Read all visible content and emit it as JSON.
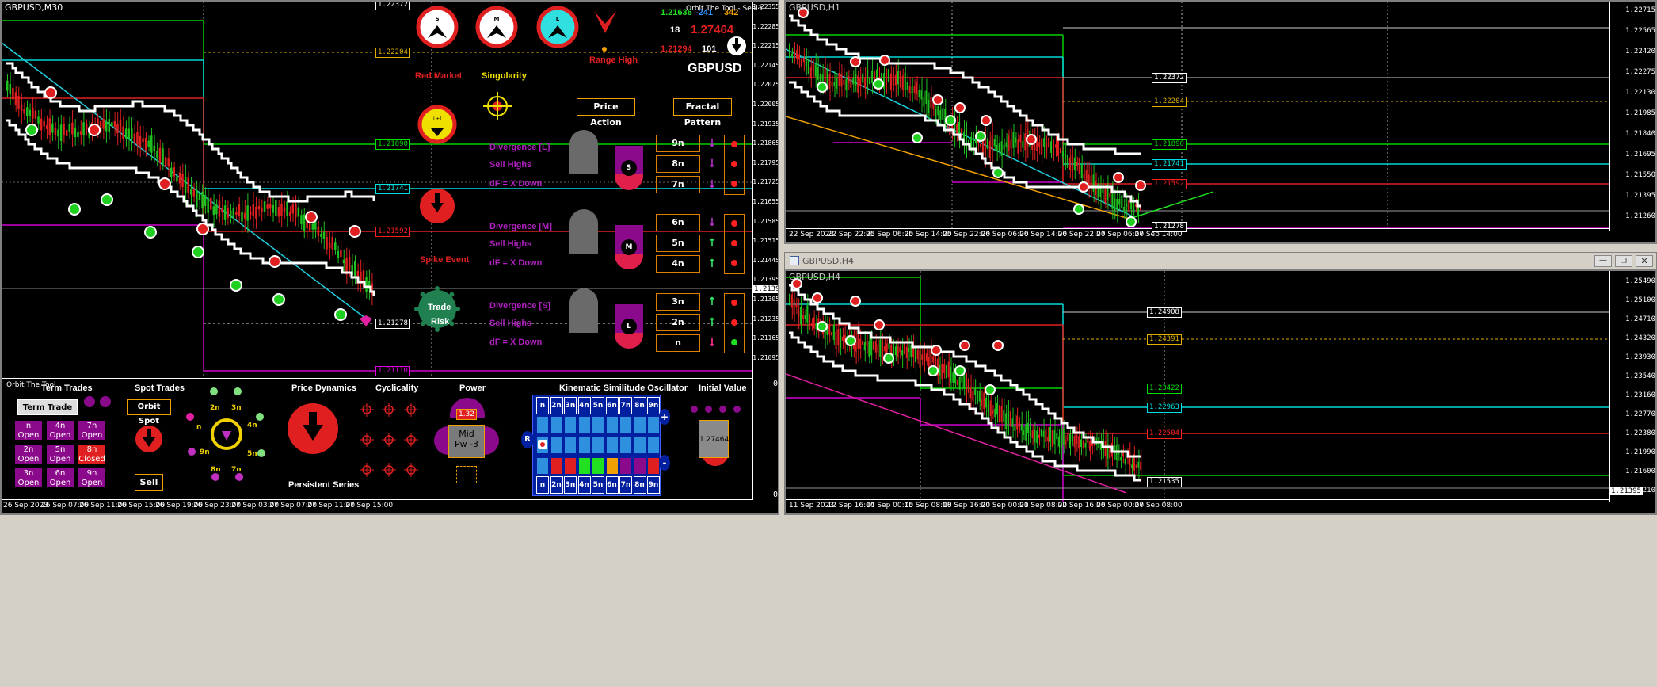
{
  "main": {
    "title": "GBPUSD,M30",
    "indicator_title": "Orbit The Tool - Seal3",
    "y_ticks": [
      "1.22355",
      "1.22285",
      "1.22215",
      "1.22145",
      "1.22075",
      "1.22005",
      "1.21935",
      "1.21865",
      "1.21795",
      "1.21725",
      "1.21655",
      "1.21585",
      "1.21515",
      "1.21445",
      "1.21395",
      "1.21305",
      "1.21235",
      "1.21165",
      "1.21095"
    ],
    "x_ticks": [
      "26 Sep 2023",
      "26 Sep 07:00",
      "26 Sep 11:00",
      "26 Sep 15:00",
      "26 Sep 19:00",
      "26 Sep 23:00",
      "27 Sep 03:00",
      "27 Sep 07:00",
      "27 Sep 11:00",
      "27 Sep 15:00"
    ],
    "pills": [
      {
        "text": "1.22204",
        "color": "#e0b000"
      },
      {
        "text": "1.21890",
        "color": "#00e000"
      },
      {
        "text": "1.21741",
        "color": "#00e0e0"
      },
      {
        "text": "1.21592",
        "color": "#ff2020"
      },
      {
        "text": "1.21278",
        "color": "#ffffff"
      },
      {
        "text": "1.21110",
        "color": "#e000e0"
      },
      {
        "text": "1.22372",
        "color": "#ffffff"
      }
    ],
    "current_price": "1.21395",
    "sub_ticks": [
      "0",
      "0"
    ]
  },
  "indicators": {
    "market_labels": [
      "S",
      "M",
      "L"
    ],
    "red_market": "Red Market",
    "singularity": "Singularity",
    "range_high": "Range High",
    "spike_event": "Spike Event",
    "trade_risk_1": "Trade",
    "trade_risk_2": "Risk",
    "lh": "L+l",
    "price_action": "Price Action",
    "fractal_pattern": "Fractal Pattern",
    "symbol": "GBPUSD",
    "top_vals": {
      "a": "1.21636",
      "b": "-241",
      "c": "342",
      "d": "18",
      "e": "1.27464",
      "f": "1.21294",
      "g": "101"
    },
    "divergence": [
      {
        "title": "Divergence [L]",
        "sell": "Sell Highs",
        "df": "dF = X Down",
        "badge": "S",
        "boxes": [
          "9n",
          "8n",
          "7n"
        ],
        "arrows": [
          "down",
          "down",
          "down"
        ],
        "dots": [
          "#ff2020",
          "#ff2020",
          "#ff2020"
        ]
      },
      {
        "title": "Divergence [M]",
        "sell": "Sell Highs",
        "df": "dF = X Down",
        "badge": "M",
        "boxes": [
          "6n",
          "5n",
          "4n"
        ],
        "arrows": [
          "down",
          "up",
          "up"
        ],
        "dots": [
          "#ff2020",
          "#ff2020",
          "#ff2020"
        ]
      },
      {
        "title": "Divergence [S]",
        "sell": "Sell Highs",
        "df": "dF = X Down",
        "badge": "L",
        "boxes": [
          "3n",
          "2n",
          "n"
        ],
        "arrows": [
          "up",
          "up",
          "downpink"
        ],
        "dots": [
          "#ff2020",
          "#ff2020",
          "#20e020"
        ]
      }
    ]
  },
  "panel": {
    "title": "Orbit The Tool",
    "term_trades": "Term Trades",
    "term_trade_hold": "Term Trade [Hold]",
    "term_buttons": [
      {
        "l1": "n",
        "l2": "Open",
        "color": "#8b0a8b"
      },
      {
        "l1": "4n",
        "l2": "Open",
        "color": "#8b0a8b"
      },
      {
        "l1": "7n",
        "l2": "Open",
        "color": "#8b0a8b"
      },
      {
        "l1": "2n",
        "l2": "Open",
        "color": "#8b0a8b"
      },
      {
        "l1": "5n",
        "l2": "Open",
        "color": "#8b0a8b"
      },
      {
        "l1": "8n",
        "l2": "Closed",
        "color": "#e02020"
      },
      {
        "l1": "3n",
        "l2": "Open",
        "color": "#8b0a8b"
      },
      {
        "l1": "6n",
        "l2": "Open",
        "color": "#8b0a8b"
      },
      {
        "l1": "9n",
        "l2": "Open",
        "color": "#8b0a8b"
      }
    ],
    "spot_trades": "Spot Trades",
    "orbit_spot": "Orbit Spot",
    "sell": "Sell",
    "orbit_labels": [
      "2n",
      "3n",
      "4n",
      "5n",
      "7n",
      "8n",
      "9n",
      "n"
    ],
    "price_dynamics": "Price Dynamics",
    "persistent_series": "Persistent Series",
    "cyclicality": "Cyclicality",
    "power": "Power",
    "power_val": "1.32",
    "power_mid": "Mid",
    "power_pw": "Pw -3",
    "kso_title": "Kinematic Similitude Oscillator",
    "kso_header": [
      "n",
      "2n",
      "3n",
      "4n",
      "5n",
      "6n",
      "7n",
      "8n",
      "9n"
    ],
    "kso_r": "R",
    "kso_plus": "+",
    "kso_minus": "-",
    "kso_row3": [
      "#3090e0",
      "#e02020",
      "#e02020",
      "#20e020",
      "#20e020",
      "#f0a000",
      "#8b0a8b",
      "#8b0a8b",
      "#e02020"
    ],
    "initial_value": "Initial Value",
    "initial_price": "1.27464"
  },
  "h1": {
    "title": "GBPUSD,H1",
    "win_title": "GBPUSD,H1",
    "y_ticks": [
      "1.22715",
      "1.22565",
      "1.22420",
      "1.22275",
      "1.22130",
      "1.21985",
      "1.21840",
      "1.21695",
      "1.21550",
      "1.21395",
      "1.21260"
    ],
    "x_ticks": [
      "22 Sep 2023",
      "22 Sep 22:00",
      "25 Sep 06:00",
      "25 Sep 14:00",
      "25 Sep 22:00",
      "26 Sep 06:00",
      "26 Sep 14:00",
      "26 Sep 22:00",
      "27 Sep 06:00",
      "27 Sep 14:00"
    ],
    "pills": [
      {
        "text": "1.22372",
        "color": "#ffffff"
      },
      {
        "text": "1.22204",
        "color": "#e0b000"
      },
      {
        "text": "1.21890",
        "color": "#00e000"
      },
      {
        "text": "1.21741",
        "color": "#00e0e0"
      },
      {
        "text": "1.21592",
        "color": "#ff2020"
      },
      {
        "text": "1.21278",
        "color": "#ffffff"
      }
    ]
  },
  "h4": {
    "title": "GBPUSD,H4",
    "win_title": "GBPUSD,H4",
    "y_ticks": [
      "1.25490",
      "1.25100",
      "1.24710",
      "1.24320",
      "1.23930",
      "1.23540",
      "1.23160",
      "1.22770",
      "1.22380",
      "1.21990",
      "1.21600",
      "1.21210"
    ],
    "x_ticks": [
      "11 Sep 2023",
      "12 Sep 16:00",
      "14 Sep 00:00",
      "15 Sep 08:00",
      "18 Sep 16:00",
      "20 Sep 00:00",
      "21 Sep 08:00",
      "22 Sep 16:00",
      "26 Sep 00:00",
      "27 Sep 08:00"
    ],
    "pills": [
      {
        "text": "1.24908",
        "color": "#ffffff"
      },
      {
        "text": "1.24391",
        "color": "#e0b000"
      },
      {
        "text": "1.23422",
        "color": "#00e000"
      },
      {
        "text": "1.22963",
        "color": "#00e0e0"
      },
      {
        "text": "1.22504",
        "color": "#ff2020"
      },
      {
        "text": "1.21535",
        "color": "#ffffff"
      }
    ],
    "current_price": "1.21395"
  }
}
